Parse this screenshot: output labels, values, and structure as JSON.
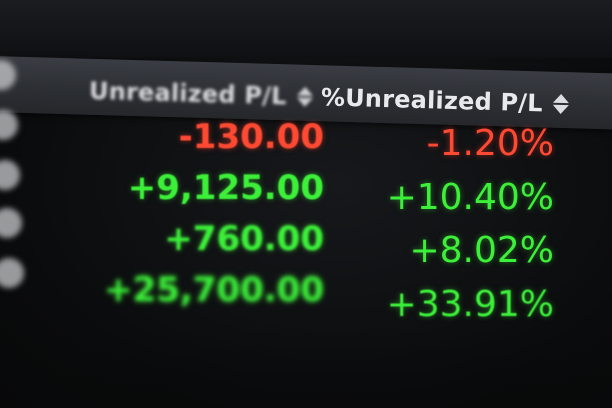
{
  "header": {
    "columns": [
      {
        "label": "Unrealized P/L",
        "sort_icon": "sort-updown-icon"
      },
      {
        "label": "%Unrealized P/L",
        "sort_icon": "sort-updown-icon"
      }
    ]
  },
  "rows": [
    {
      "unrealized_pl": "-130.00",
      "pct_unrealized_pl": "-1.20%",
      "direction": "negative"
    },
    {
      "unrealized_pl": "+9,125.00",
      "pct_unrealized_pl": "+10.40%",
      "direction": "positive"
    },
    {
      "unrealized_pl": "+760.00",
      "pct_unrealized_pl": "+8.02%",
      "direction": "positive"
    },
    {
      "unrealized_pl": "+25,700.00",
      "pct_unrealized_pl": "+33.91%",
      "direction": "positive"
    }
  ],
  "colors": {
    "negative": "#ff4a33",
    "positive": "#3cf03a",
    "header_bg": "#2c2f34",
    "header_text": "#e8e9ec",
    "background": "#0c0d0f"
  }
}
